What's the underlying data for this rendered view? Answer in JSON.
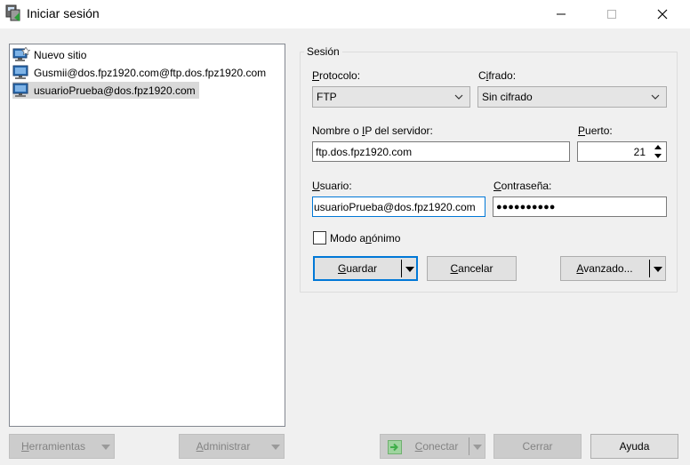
{
  "window": {
    "title": "Iniciar sesión"
  },
  "tree": {
    "items": [
      {
        "label": "Nuevo sitio",
        "icon": "new-site-icon",
        "selected": false
      },
      {
        "label": "Gusmii@dos.fpz1920.com@ftp.dos.fpz1920.com",
        "icon": "computer-icon",
        "selected": false
      },
      {
        "label": "usuarioPrueba@dos.fpz1920.com",
        "icon": "computer-icon",
        "selected": true
      }
    ]
  },
  "session": {
    "group_label": "Sesión",
    "protocol_label": "Protocolo:",
    "protocol_value": "FTP",
    "encryption_label": "Cifrado:",
    "encryption_value": "Sin cifrado",
    "host_label": "Nombre o IP del servidor:",
    "host_value": "ftp.dos.fpz1920.com",
    "port_label": "Puerto:",
    "port_value": "21",
    "user_label": "Usuario:",
    "user_value": "usuarioPrueba@dos.fpz1920.com",
    "password_label": "Contraseña:",
    "password_value": "●●●●●●●●●●",
    "anonymous_label": "Modo anónimo",
    "anonymous_checked": false,
    "save_button": "Guardar",
    "cancel_button": "Cancelar",
    "advanced_button": "Avanzado..."
  },
  "footer": {
    "tools_button": "Herramientas",
    "manage_button": "Administrar",
    "connect_button": "Conectar",
    "close_button": "Cerrar",
    "help_button": "Ayuda"
  },
  "colors": {
    "focus": "#0078d7",
    "connect_icon": "#3fae49"
  }
}
